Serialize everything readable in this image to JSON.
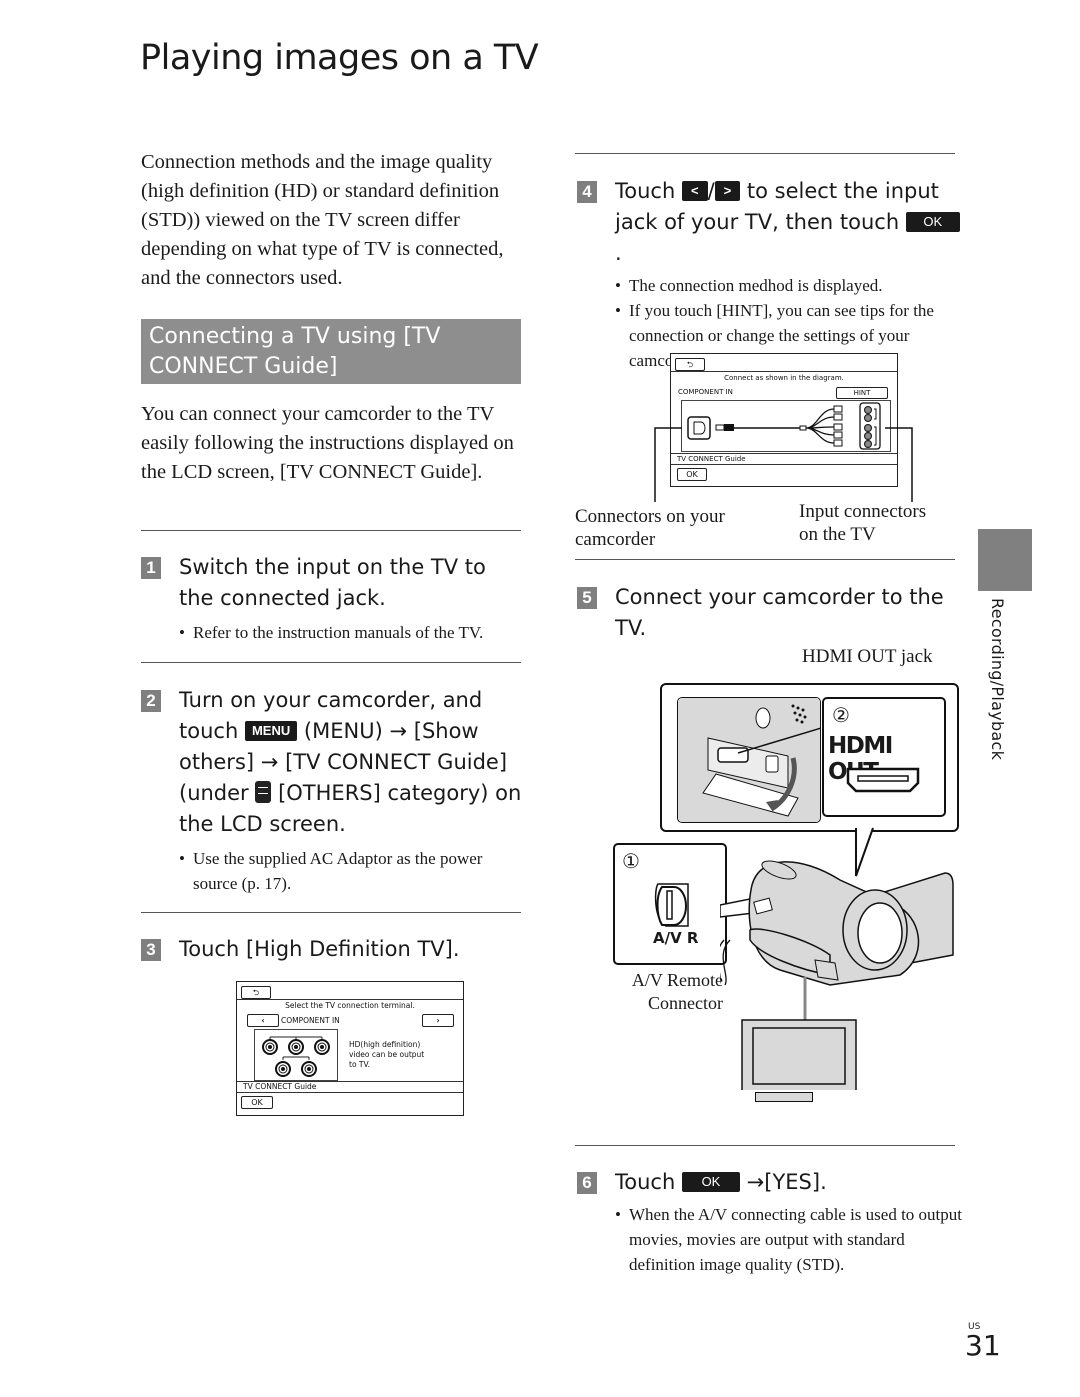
{
  "page": {
    "title": "Playing images on a TV",
    "intro": "Connection methods and the image quality (high definition (HD) or standard definition (STD)) viewed on the TV screen differ depending on what type of TV is connected, and the connectors used.",
    "section_heading": "Connecting a TV using [TV CONNECT Guide]",
    "section_intro": "You can connect your camcorder to the TV easily following the instructions displayed on the LCD screen, [TV CONNECT Guide].",
    "side_label": "Recording/Playback",
    "page_region": "US",
    "page_number": "31"
  },
  "steps": [
    {
      "num": "1",
      "heading": "Switch the input on the TV to the connected jack.",
      "bullets": [
        "Refer to the instruction manuals of the TV."
      ]
    },
    {
      "num": "2",
      "heading_parts": {
        "a": "Turn on your camcorder, and touch",
        "menu_icon": "MENU",
        "b": "(MENU)",
        "arrow": "→",
        "c": "[Show others]",
        "d": "[TV CONNECT Guide] (under",
        "others_icon": "others-category-icon",
        "e": "[OTHERS] category) on the LCD screen."
      },
      "bullets": [
        "Use the supplied AC Adaptor as the power source (p. 17)."
      ]
    },
    {
      "num": "3",
      "heading": "Touch [High Definition TV].",
      "screen": {
        "back": "⮌",
        "prompt": "Select the TV connection terminal.",
        "prev": "‹",
        "selected": "COMPONENT IN",
        "next": "›",
        "description": [
          "HD(high definition)",
          "video can be output",
          "to TV."
        ],
        "footer": "TV CONNECT Guide",
        "ok": "OK"
      }
    },
    {
      "num": "4",
      "heading_parts": {
        "a": "Touch",
        "prev_icon": "<",
        "slash": "/",
        "next_icon": ">",
        "b": "to select the input jack of your TV, then touch",
        "ok_icon": "OK",
        "c": "."
      },
      "bullets": [
        "The connection medhod is displayed.",
        "If you touch [HINT], you can see tips for the connection or change the settings of your camcorder."
      ],
      "screen": {
        "back": "⮌",
        "prompt": "Connect as shown in the diagram.",
        "selected": "COMPONENT IN",
        "hint": "HINT",
        "footer": "TV CONNECT Guide",
        "ok": "OK"
      },
      "callouts": {
        "left": "Connectors on your camcorder",
        "right": "Input connectors on the TV"
      }
    },
    {
      "num": "5",
      "heading": "Connect your camcorder to the TV.",
      "figure": {
        "jack_label": "HDMI OUT jack",
        "marker_2": "②",
        "hdmi_label": "HDMI OUT",
        "marker_1": "①",
        "avr_label": "A/V R",
        "connector_label_1": "A/V Remote",
        "connector_label_2": "Connector"
      }
    },
    {
      "num": "6",
      "heading_parts": {
        "a": "Touch",
        "ok_icon": "OK",
        "arrow": "→",
        "b": "[YES]."
      },
      "bullets": [
        "When the A/V connecting cable is used to output movies, movies are output with standard definition image quality (STD)."
      ]
    }
  ]
}
